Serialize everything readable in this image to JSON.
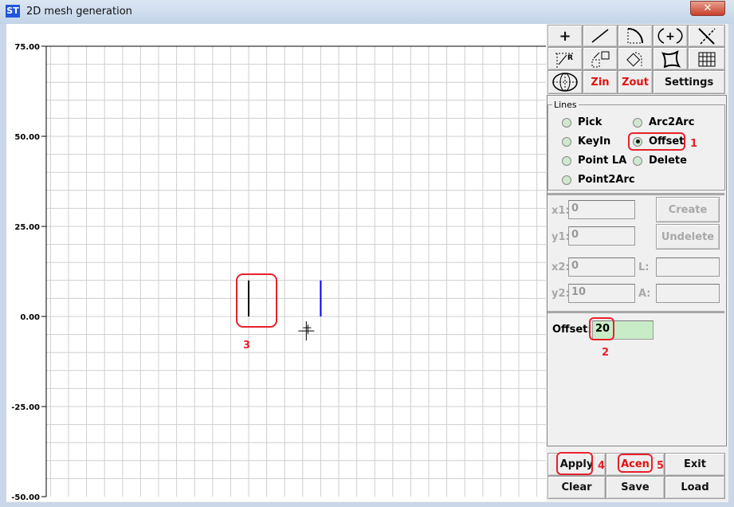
{
  "window": {
    "title": "2D mesh generation",
    "close": "✕"
  },
  "plot": {
    "y_ticks": [
      "75.00",
      "50.00",
      "25.00",
      "0.00",
      "-25.00",
      "-50.00"
    ],
    "y_values": [
      75,
      50,
      25,
      0,
      -25,
      -50
    ],
    "grid_step": 5,
    "lines": [
      {
        "x1": 0,
        "y1": 0,
        "x2": 0,
        "y2": 10,
        "color": "#000000"
      },
      {
        "x1": 20,
        "y1": 0,
        "x2": 20,
        "y2": 10,
        "color": "#0000ee"
      }
    ],
    "cursor": {
      "x": 16,
      "y": -4
    }
  },
  "toolbar": {
    "zin": "Zin",
    "zout": "Zout",
    "settings": "Settings"
  },
  "lines_group": {
    "label": "Lines",
    "options": [
      "Pick",
      "Arc2Arc",
      "KeyIn",
      "Offset",
      "Point LA",
      "Delete",
      "Point2Arc"
    ],
    "selected": "Offset"
  },
  "fields": {
    "x1_label": "x1:",
    "x1": "0",
    "y1_label": "y1:",
    "y1": "0",
    "x2_label": "x2:",
    "x2": "0",
    "y2_label": "y2:",
    "y2": "10",
    "l_label": "L:",
    "l": "",
    "a_label": "A:",
    "a": "",
    "create": "Create",
    "undelete": "Undelete"
  },
  "offset": {
    "label": "Offset:",
    "value": "20"
  },
  "buttons": {
    "apply": "Apply",
    "acen": "Acen",
    "exit": "Exit",
    "clear": "Clear",
    "save": "Save",
    "load": "Load"
  },
  "annotations": [
    "1",
    "2",
    "3",
    "4",
    "5"
  ]
}
